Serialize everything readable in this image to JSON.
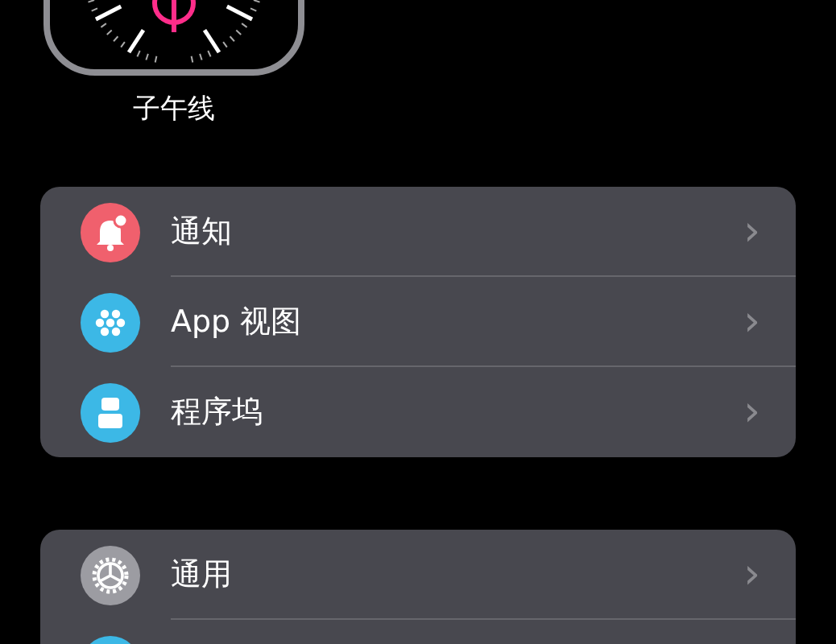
{
  "watch_face": {
    "name": "子午线"
  },
  "groups": [
    {
      "items": [
        {
          "label": "通知",
          "kind": "bell",
          "color": "#f0606d"
        },
        {
          "label": "App 视图",
          "kind": "dots",
          "color": "#3cb8e6"
        },
        {
          "label": "程序坞",
          "kind": "dock",
          "color": "#3cb8e6"
        }
      ]
    },
    {
      "items": [
        {
          "label": "通用",
          "kind": "gear",
          "color": "#9c9ca2"
        },
        {
          "kind": "blank",
          "color": "#3cb8e6"
        }
      ]
    }
  ],
  "chevron": "›"
}
